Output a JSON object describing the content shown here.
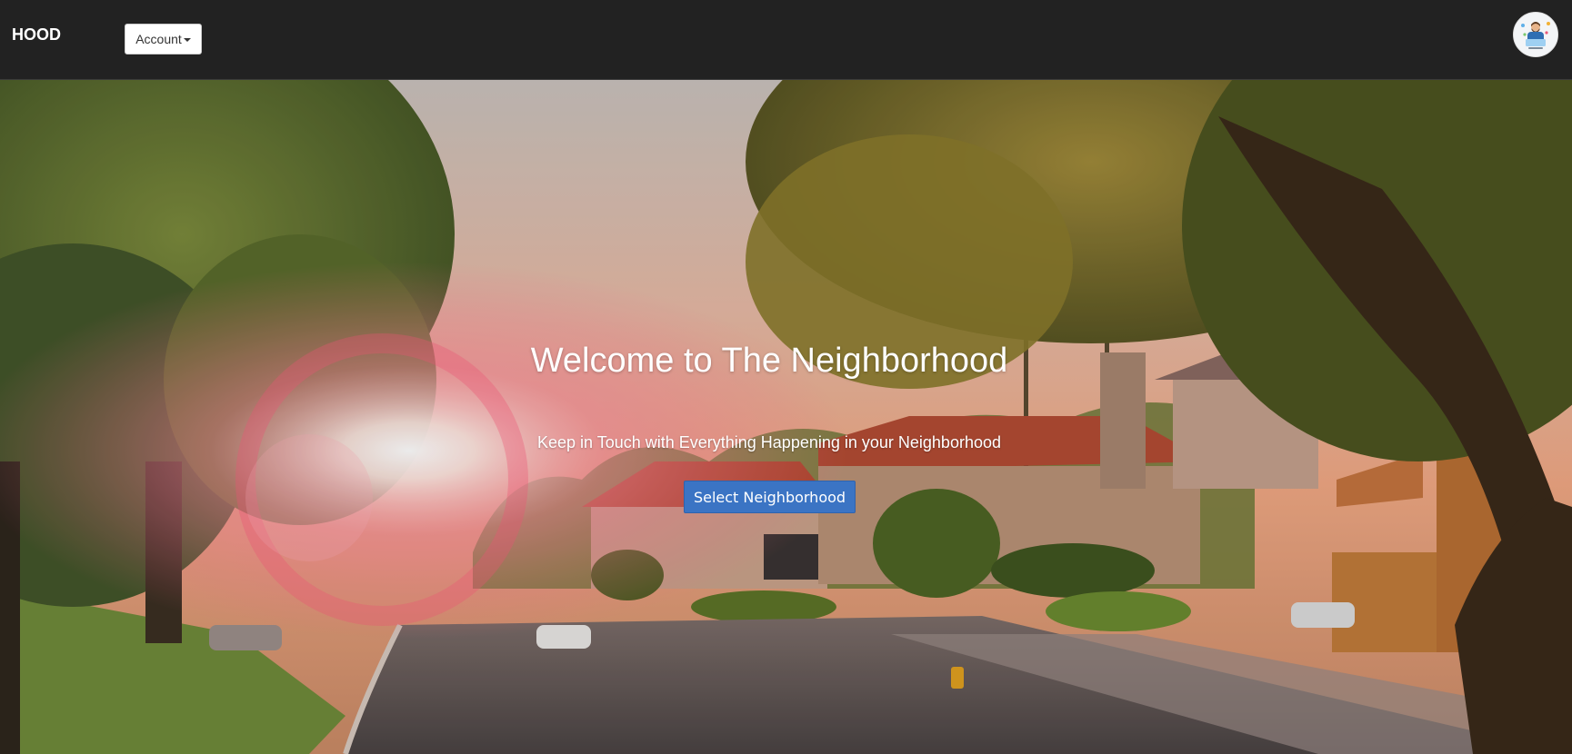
{
  "navbar": {
    "brand": "HOOD",
    "account_label": "Account",
    "avatar_icon": "user-avatar-icon"
  },
  "hero": {
    "title": "Welcome to The Neighborhood",
    "subtitle": "Keep in Touch with Everything Happening in your Neighborhood",
    "cta_label": "Select Neighborhood"
  },
  "colors": {
    "navbar_bg": "#222222",
    "cta_bg": "#3b74c4",
    "hero_text": "#ffffff"
  }
}
